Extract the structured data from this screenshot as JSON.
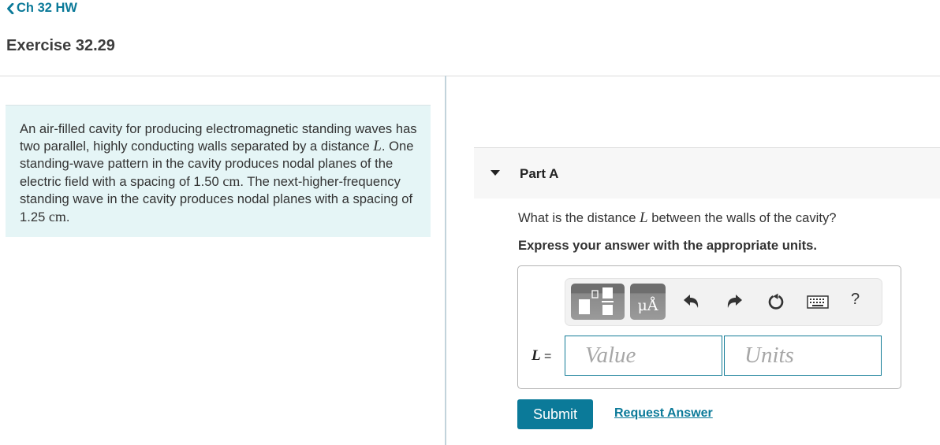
{
  "nav": {
    "back_label": "Ch 32 HW",
    "back_icon": "chevron-left-icon"
  },
  "page": {
    "title": "Exercise 32.29"
  },
  "problem": {
    "text_parts": [
      "An air-filled cavity for producing electromagnetic standing waves has two parallel, highly conducting walls separated by a distance ",
      "L",
      ". One standing-wave pattern in the cavity produces nodal planes of the electric field with a spacing of 1.50 ",
      "cm",
      ". The next-higher-frequency standing wave in the cavity produces nodal planes with a spacing of 1.25 ",
      "cm",
      "."
    ]
  },
  "part": {
    "title": "Part A",
    "expand_icon": "caret-down-icon",
    "question_parts": [
      "What is the distance ",
      "L",
      " between the walls of the cavity?"
    ],
    "instruction": "Express your answer with the appropriate units."
  },
  "toolbar": {
    "templates_icon": "templates-icon",
    "units_label": "μÅ",
    "undo_icon": "undo-icon",
    "redo_icon": "redo-icon",
    "reset_icon": "reset-icon",
    "keyboard_icon": "keyboard-icon",
    "help_label": "?"
  },
  "answer": {
    "variable": "L",
    "equals": " =",
    "value_placeholder": "Value",
    "value": "",
    "units_placeholder": "Units",
    "units": ""
  },
  "actions": {
    "submit_label": "Submit",
    "request_answer_label": "Request Answer"
  }
}
